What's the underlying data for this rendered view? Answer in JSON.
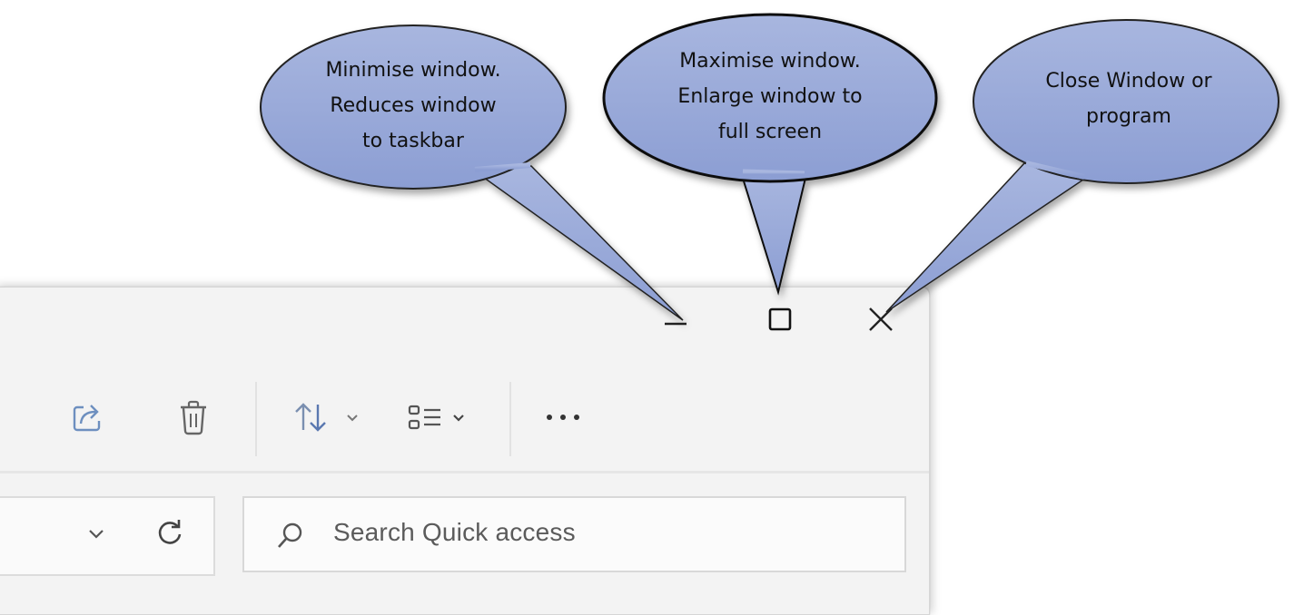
{
  "window": {
    "caption": {
      "minimize_icon": "minimize-icon",
      "maximize_icon": "maximize-icon",
      "close_icon": "close-icon"
    },
    "toolbar": {
      "items": [
        "copy-icon",
        "share-icon",
        "delete-icon",
        "sort-icon",
        "view-icon",
        "more-options-icon"
      ]
    },
    "address_bar": {
      "icons": [
        "chevron-down-icon",
        "refresh-icon"
      ]
    },
    "search": {
      "placeholder": "Search Quick access",
      "icon": "search-icon"
    }
  },
  "callouts": {
    "minimise": {
      "line1": "Minimise window.",
      "line2": "Reduces window",
      "line3": "to taskbar"
    },
    "maximise": {
      "line1": "Maximise window.",
      "line2": "Enlarge window to",
      "line3": "full screen"
    },
    "close": {
      "line1": "Close Window or",
      "line2": "program"
    }
  },
  "colors": {
    "callout_fill": "#9aaad8",
    "callout_stroke": "#101010",
    "window_bg": "#f3f3f3"
  }
}
